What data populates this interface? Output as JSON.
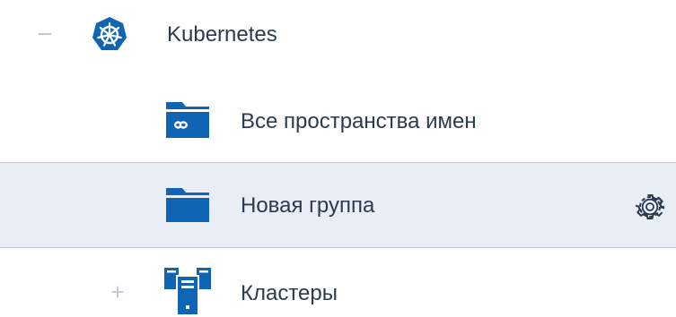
{
  "tree": {
    "root": {
      "toggle": "−",
      "icon": "kubernetes-helm-icon",
      "label": "Kubernetes"
    },
    "items": [
      {
        "icon": "folder-infinity-icon",
        "label": "Все пространства имен",
        "selected": false
      },
      {
        "icon": "folder-icon",
        "label": "Новая группа",
        "selected": true,
        "action_icon": "gear-icon"
      },
      {
        "toggle": "+",
        "icon": "cluster-servers-icon",
        "label": "Кластеры",
        "selected": false
      }
    ]
  },
  "colors": {
    "icon_blue": "#0f64b4",
    "selected_bg": "#e8edf6",
    "selected_border": "#bfcbe0",
    "text": "#2b3a4f",
    "muted": "#c2c8d0"
  }
}
